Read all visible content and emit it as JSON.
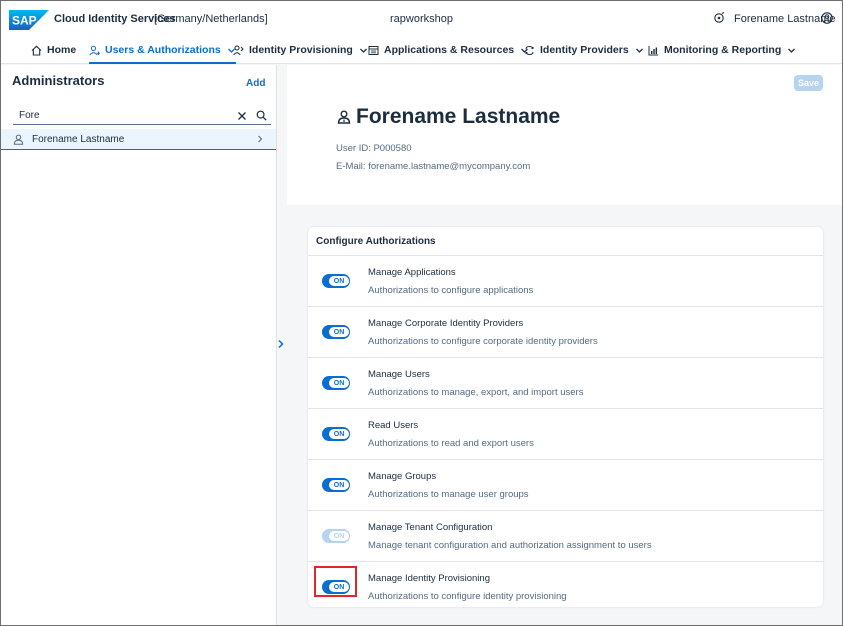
{
  "shell": {
    "logo_text": "SAP",
    "app_name": "Cloud Identity Services",
    "region": "[Germany/Netherlands]",
    "tenant": "rapworkshop",
    "user_name": "Forename Lastname",
    "brand_color": "#0a6ed1"
  },
  "nav": {
    "tabs": [
      {
        "label": "Home",
        "icon": "home-icon",
        "active": false,
        "has_menu": false
      },
      {
        "label": "Users & Authorizations",
        "icon": "users-icon",
        "active": true,
        "has_menu": true
      },
      {
        "label": "Identity Provisioning",
        "icon": "provisioning-icon",
        "active": false,
        "has_menu": true
      },
      {
        "label": "Applications & Resources",
        "icon": "applications-icon",
        "active": false,
        "has_menu": true
      },
      {
        "label": "Identity Providers",
        "icon": "identity-providers-icon",
        "active": false,
        "has_menu": true
      },
      {
        "label": "Monitoring & Reporting",
        "icon": "monitoring-icon",
        "active": false,
        "has_menu": true
      }
    ]
  },
  "left": {
    "title": "Administrators",
    "add_label": "Add",
    "search_value": "Fore",
    "items": [
      {
        "label": "Forename Lastname"
      }
    ]
  },
  "detail": {
    "save_label": "Save",
    "name": "Forename Lastname",
    "user_id": "User ID: P000580",
    "email": "E-Mail: forename.lastname@mycompany.com"
  },
  "authorizations": {
    "title": "Configure Authorizations",
    "on_label": "ON",
    "items": [
      {
        "title": "Manage Applications",
        "desc": "Authorizations to configure applications",
        "state": "on",
        "enabled": true
      },
      {
        "title": "Manage Corporate Identity Providers",
        "desc": "Authorizations to configure corporate identity providers",
        "state": "on",
        "enabled": true
      },
      {
        "title": "Manage Users",
        "desc": "Authorizations to manage, export, and import users",
        "state": "on",
        "enabled": true
      },
      {
        "title": "Read Users",
        "desc": "Authorizations to read and export users",
        "state": "on",
        "enabled": true
      },
      {
        "title": "Manage Groups",
        "desc": "Authorizations to manage user groups",
        "state": "on",
        "enabled": true
      },
      {
        "title": "Manage Tenant Configuration",
        "desc": "Manage tenant configuration and authorization assignment to users",
        "state": "on",
        "enabled": false
      },
      {
        "title": "Manage Identity Provisioning",
        "desc": "Authorizations to configure identity provisioning",
        "state": "on",
        "enabled": true,
        "highlighted": true
      }
    ]
  }
}
